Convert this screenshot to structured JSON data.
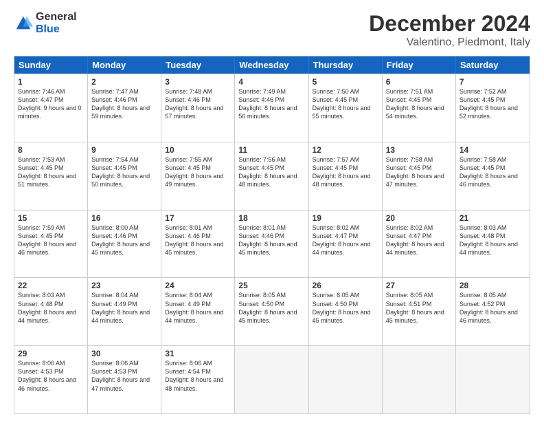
{
  "logo": {
    "general": "General",
    "blue": "Blue"
  },
  "title": "December 2024",
  "location": "Valentino, Piedmont, Italy",
  "days": [
    "Sunday",
    "Monday",
    "Tuesday",
    "Wednesday",
    "Thursday",
    "Friday",
    "Saturday"
  ],
  "weeks": [
    [
      {
        "day": "1",
        "sunrise": "Sunrise: 7:46 AM",
        "sunset": "Sunset: 4:47 PM",
        "daylight": "Daylight: 9 hours and 0 minutes."
      },
      {
        "day": "2",
        "sunrise": "Sunrise: 7:47 AM",
        "sunset": "Sunset: 4:46 PM",
        "daylight": "Daylight: 8 hours and 59 minutes."
      },
      {
        "day": "3",
        "sunrise": "Sunrise: 7:48 AM",
        "sunset": "Sunset: 4:46 PM",
        "daylight": "Daylight: 8 hours and 57 minutes."
      },
      {
        "day": "4",
        "sunrise": "Sunrise: 7:49 AM",
        "sunset": "Sunset: 4:46 PM",
        "daylight": "Daylight: 8 hours and 56 minutes."
      },
      {
        "day": "5",
        "sunrise": "Sunrise: 7:50 AM",
        "sunset": "Sunset: 4:45 PM",
        "daylight": "Daylight: 8 hours and 55 minutes."
      },
      {
        "day": "6",
        "sunrise": "Sunrise: 7:51 AM",
        "sunset": "Sunset: 4:45 PM",
        "daylight": "Daylight: 8 hours and 54 minutes."
      },
      {
        "day": "7",
        "sunrise": "Sunrise: 7:52 AM",
        "sunset": "Sunset: 4:45 PM",
        "daylight": "Daylight: 8 hours and 52 minutes."
      }
    ],
    [
      {
        "day": "8",
        "sunrise": "Sunrise: 7:53 AM",
        "sunset": "Sunset: 4:45 PM",
        "daylight": "Daylight: 8 hours and 51 minutes."
      },
      {
        "day": "9",
        "sunrise": "Sunrise: 7:54 AM",
        "sunset": "Sunset: 4:45 PM",
        "daylight": "Daylight: 8 hours and 50 minutes."
      },
      {
        "day": "10",
        "sunrise": "Sunrise: 7:55 AM",
        "sunset": "Sunset: 4:45 PM",
        "daylight": "Daylight: 8 hours and 49 minutes."
      },
      {
        "day": "11",
        "sunrise": "Sunrise: 7:56 AM",
        "sunset": "Sunset: 4:45 PM",
        "daylight": "Daylight: 8 hours and 48 minutes."
      },
      {
        "day": "12",
        "sunrise": "Sunrise: 7:57 AM",
        "sunset": "Sunset: 4:45 PM",
        "daylight": "Daylight: 8 hours and 48 minutes."
      },
      {
        "day": "13",
        "sunrise": "Sunrise: 7:58 AM",
        "sunset": "Sunset: 4:45 PM",
        "daylight": "Daylight: 8 hours and 47 minutes."
      },
      {
        "day": "14",
        "sunrise": "Sunrise: 7:58 AM",
        "sunset": "Sunset: 4:45 PM",
        "daylight": "Daylight: 8 hours and 46 minutes."
      }
    ],
    [
      {
        "day": "15",
        "sunrise": "Sunrise: 7:59 AM",
        "sunset": "Sunset: 4:45 PM",
        "daylight": "Daylight: 8 hours and 46 minutes."
      },
      {
        "day": "16",
        "sunrise": "Sunrise: 8:00 AM",
        "sunset": "Sunset: 4:46 PM",
        "daylight": "Daylight: 8 hours and 45 minutes."
      },
      {
        "day": "17",
        "sunrise": "Sunrise: 8:01 AM",
        "sunset": "Sunset: 4:46 PM",
        "daylight": "Daylight: 8 hours and 45 minutes."
      },
      {
        "day": "18",
        "sunrise": "Sunrise: 8:01 AM",
        "sunset": "Sunset: 4:46 PM",
        "daylight": "Daylight: 8 hours and 45 minutes."
      },
      {
        "day": "19",
        "sunrise": "Sunrise: 8:02 AM",
        "sunset": "Sunset: 4:47 PM",
        "daylight": "Daylight: 8 hours and 44 minutes."
      },
      {
        "day": "20",
        "sunrise": "Sunrise: 8:02 AM",
        "sunset": "Sunset: 4:47 PM",
        "daylight": "Daylight: 8 hours and 44 minutes."
      },
      {
        "day": "21",
        "sunrise": "Sunrise: 8:03 AM",
        "sunset": "Sunset: 4:48 PM",
        "daylight": "Daylight: 8 hours and 44 minutes."
      }
    ],
    [
      {
        "day": "22",
        "sunrise": "Sunrise: 8:03 AM",
        "sunset": "Sunset: 4:48 PM",
        "daylight": "Daylight: 8 hours and 44 minutes."
      },
      {
        "day": "23",
        "sunrise": "Sunrise: 8:04 AM",
        "sunset": "Sunset: 4:49 PM",
        "daylight": "Daylight: 8 hours and 44 minutes."
      },
      {
        "day": "24",
        "sunrise": "Sunrise: 8:04 AM",
        "sunset": "Sunset: 4:49 PM",
        "daylight": "Daylight: 8 hours and 44 minutes."
      },
      {
        "day": "25",
        "sunrise": "Sunrise: 8:05 AM",
        "sunset": "Sunset: 4:50 PM",
        "daylight": "Daylight: 8 hours and 45 minutes."
      },
      {
        "day": "26",
        "sunrise": "Sunrise: 8:05 AM",
        "sunset": "Sunset: 4:50 PM",
        "daylight": "Daylight: 8 hours and 45 minutes."
      },
      {
        "day": "27",
        "sunrise": "Sunrise: 8:05 AM",
        "sunset": "Sunset: 4:51 PM",
        "daylight": "Daylight: 8 hours and 45 minutes."
      },
      {
        "day": "28",
        "sunrise": "Sunrise: 8:05 AM",
        "sunset": "Sunset: 4:52 PM",
        "daylight": "Daylight: 8 hours and 46 minutes."
      }
    ],
    [
      {
        "day": "29",
        "sunrise": "Sunrise: 8:06 AM",
        "sunset": "Sunset: 4:53 PM",
        "daylight": "Daylight: 8 hours and 46 minutes."
      },
      {
        "day": "30",
        "sunrise": "Sunrise: 8:06 AM",
        "sunset": "Sunset: 4:53 PM",
        "daylight": "Daylight: 8 hours and 47 minutes."
      },
      {
        "day": "31",
        "sunrise": "Sunrise: 8:06 AM",
        "sunset": "Sunset: 4:54 PM",
        "daylight": "Daylight: 8 hours and 48 minutes."
      },
      null,
      null,
      null,
      null
    ]
  ]
}
